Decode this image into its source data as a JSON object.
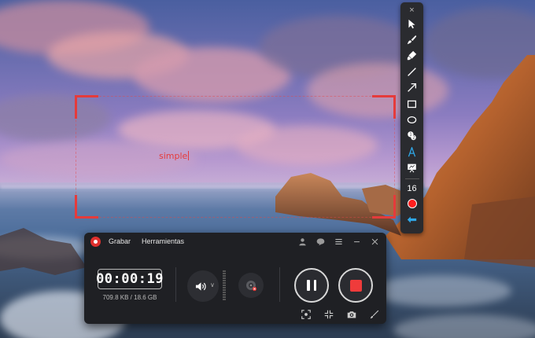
{
  "annotation": {
    "text": "simple"
  },
  "toolbar": {
    "close_glyph": "×",
    "tools": [
      {
        "id": "select",
        "icon": "cursor-icon"
      },
      {
        "id": "brush",
        "icon": "brush-icon"
      },
      {
        "id": "highlighter",
        "icon": "highlighter-icon"
      },
      {
        "id": "line",
        "icon": "line-icon"
      },
      {
        "id": "arrow",
        "icon": "arrow-icon"
      },
      {
        "id": "rectangle",
        "icon": "rectangle-icon"
      },
      {
        "id": "ellipse",
        "icon": "ellipse-icon"
      },
      {
        "id": "number-marker",
        "icon": "number-marker-icon"
      },
      {
        "id": "text",
        "icon": "text-icon"
      },
      {
        "id": "whiteboard",
        "icon": "whiteboard-icon"
      }
    ],
    "brush_size": "16",
    "active_color": "#ff1f1f",
    "accent_color": "#2fa8e8"
  },
  "recorder": {
    "menu": {
      "record": "Grabar",
      "tools": "Herramientas"
    },
    "timer": "00:00:19",
    "file_size": "709.8 KB / 18.6 GB",
    "logo_color": "#e0302e",
    "stop_color": "#ef3b3b"
  }
}
